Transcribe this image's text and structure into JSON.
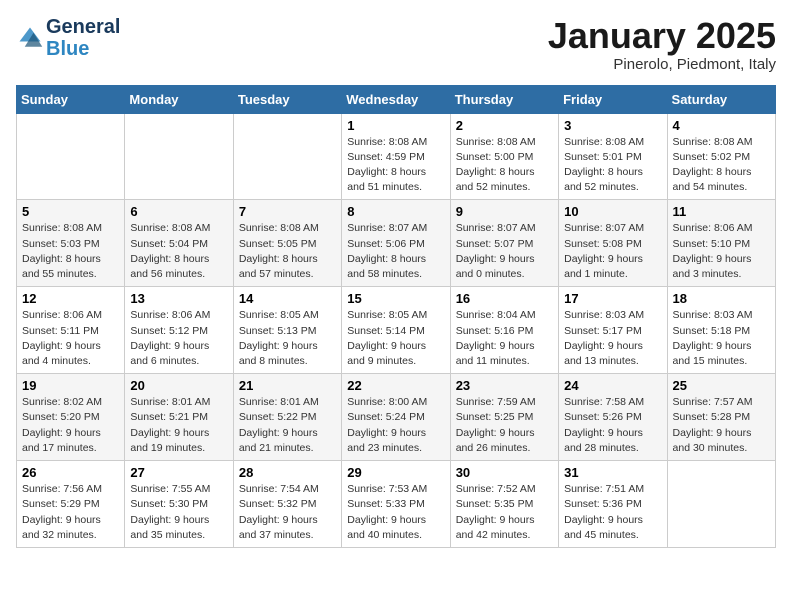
{
  "header": {
    "logo_line1": "General",
    "logo_line2": "Blue",
    "month": "January 2025",
    "location": "Pinerolo, Piedmont, Italy"
  },
  "weekdays": [
    "Sunday",
    "Monday",
    "Tuesday",
    "Wednesday",
    "Thursday",
    "Friday",
    "Saturday"
  ],
  "weeks": [
    [
      {
        "day": "",
        "info": ""
      },
      {
        "day": "",
        "info": ""
      },
      {
        "day": "",
        "info": ""
      },
      {
        "day": "1",
        "info": "Sunrise: 8:08 AM\nSunset: 4:59 PM\nDaylight: 8 hours and 51 minutes."
      },
      {
        "day": "2",
        "info": "Sunrise: 8:08 AM\nSunset: 5:00 PM\nDaylight: 8 hours and 52 minutes."
      },
      {
        "day": "3",
        "info": "Sunrise: 8:08 AM\nSunset: 5:01 PM\nDaylight: 8 hours and 52 minutes."
      },
      {
        "day": "4",
        "info": "Sunrise: 8:08 AM\nSunset: 5:02 PM\nDaylight: 8 hours and 54 minutes."
      }
    ],
    [
      {
        "day": "5",
        "info": "Sunrise: 8:08 AM\nSunset: 5:03 PM\nDaylight: 8 hours and 55 minutes."
      },
      {
        "day": "6",
        "info": "Sunrise: 8:08 AM\nSunset: 5:04 PM\nDaylight: 8 hours and 56 minutes."
      },
      {
        "day": "7",
        "info": "Sunrise: 8:08 AM\nSunset: 5:05 PM\nDaylight: 8 hours and 57 minutes."
      },
      {
        "day": "8",
        "info": "Sunrise: 8:07 AM\nSunset: 5:06 PM\nDaylight: 8 hours and 58 minutes."
      },
      {
        "day": "9",
        "info": "Sunrise: 8:07 AM\nSunset: 5:07 PM\nDaylight: 9 hours and 0 minutes."
      },
      {
        "day": "10",
        "info": "Sunrise: 8:07 AM\nSunset: 5:08 PM\nDaylight: 9 hours and 1 minute."
      },
      {
        "day": "11",
        "info": "Sunrise: 8:06 AM\nSunset: 5:10 PM\nDaylight: 9 hours and 3 minutes."
      }
    ],
    [
      {
        "day": "12",
        "info": "Sunrise: 8:06 AM\nSunset: 5:11 PM\nDaylight: 9 hours and 4 minutes."
      },
      {
        "day": "13",
        "info": "Sunrise: 8:06 AM\nSunset: 5:12 PM\nDaylight: 9 hours and 6 minutes."
      },
      {
        "day": "14",
        "info": "Sunrise: 8:05 AM\nSunset: 5:13 PM\nDaylight: 9 hours and 8 minutes."
      },
      {
        "day": "15",
        "info": "Sunrise: 8:05 AM\nSunset: 5:14 PM\nDaylight: 9 hours and 9 minutes."
      },
      {
        "day": "16",
        "info": "Sunrise: 8:04 AM\nSunset: 5:16 PM\nDaylight: 9 hours and 11 minutes."
      },
      {
        "day": "17",
        "info": "Sunrise: 8:03 AM\nSunset: 5:17 PM\nDaylight: 9 hours and 13 minutes."
      },
      {
        "day": "18",
        "info": "Sunrise: 8:03 AM\nSunset: 5:18 PM\nDaylight: 9 hours and 15 minutes."
      }
    ],
    [
      {
        "day": "19",
        "info": "Sunrise: 8:02 AM\nSunset: 5:20 PM\nDaylight: 9 hours and 17 minutes."
      },
      {
        "day": "20",
        "info": "Sunrise: 8:01 AM\nSunset: 5:21 PM\nDaylight: 9 hours and 19 minutes."
      },
      {
        "day": "21",
        "info": "Sunrise: 8:01 AM\nSunset: 5:22 PM\nDaylight: 9 hours and 21 minutes."
      },
      {
        "day": "22",
        "info": "Sunrise: 8:00 AM\nSunset: 5:24 PM\nDaylight: 9 hours and 23 minutes."
      },
      {
        "day": "23",
        "info": "Sunrise: 7:59 AM\nSunset: 5:25 PM\nDaylight: 9 hours and 26 minutes."
      },
      {
        "day": "24",
        "info": "Sunrise: 7:58 AM\nSunset: 5:26 PM\nDaylight: 9 hours and 28 minutes."
      },
      {
        "day": "25",
        "info": "Sunrise: 7:57 AM\nSunset: 5:28 PM\nDaylight: 9 hours and 30 minutes."
      }
    ],
    [
      {
        "day": "26",
        "info": "Sunrise: 7:56 AM\nSunset: 5:29 PM\nDaylight: 9 hours and 32 minutes."
      },
      {
        "day": "27",
        "info": "Sunrise: 7:55 AM\nSunset: 5:30 PM\nDaylight: 9 hours and 35 minutes."
      },
      {
        "day": "28",
        "info": "Sunrise: 7:54 AM\nSunset: 5:32 PM\nDaylight: 9 hours and 37 minutes."
      },
      {
        "day": "29",
        "info": "Sunrise: 7:53 AM\nSunset: 5:33 PM\nDaylight: 9 hours and 40 minutes."
      },
      {
        "day": "30",
        "info": "Sunrise: 7:52 AM\nSunset: 5:35 PM\nDaylight: 9 hours and 42 minutes."
      },
      {
        "day": "31",
        "info": "Sunrise: 7:51 AM\nSunset: 5:36 PM\nDaylight: 9 hours and 45 minutes."
      },
      {
        "day": "",
        "info": ""
      }
    ]
  ]
}
